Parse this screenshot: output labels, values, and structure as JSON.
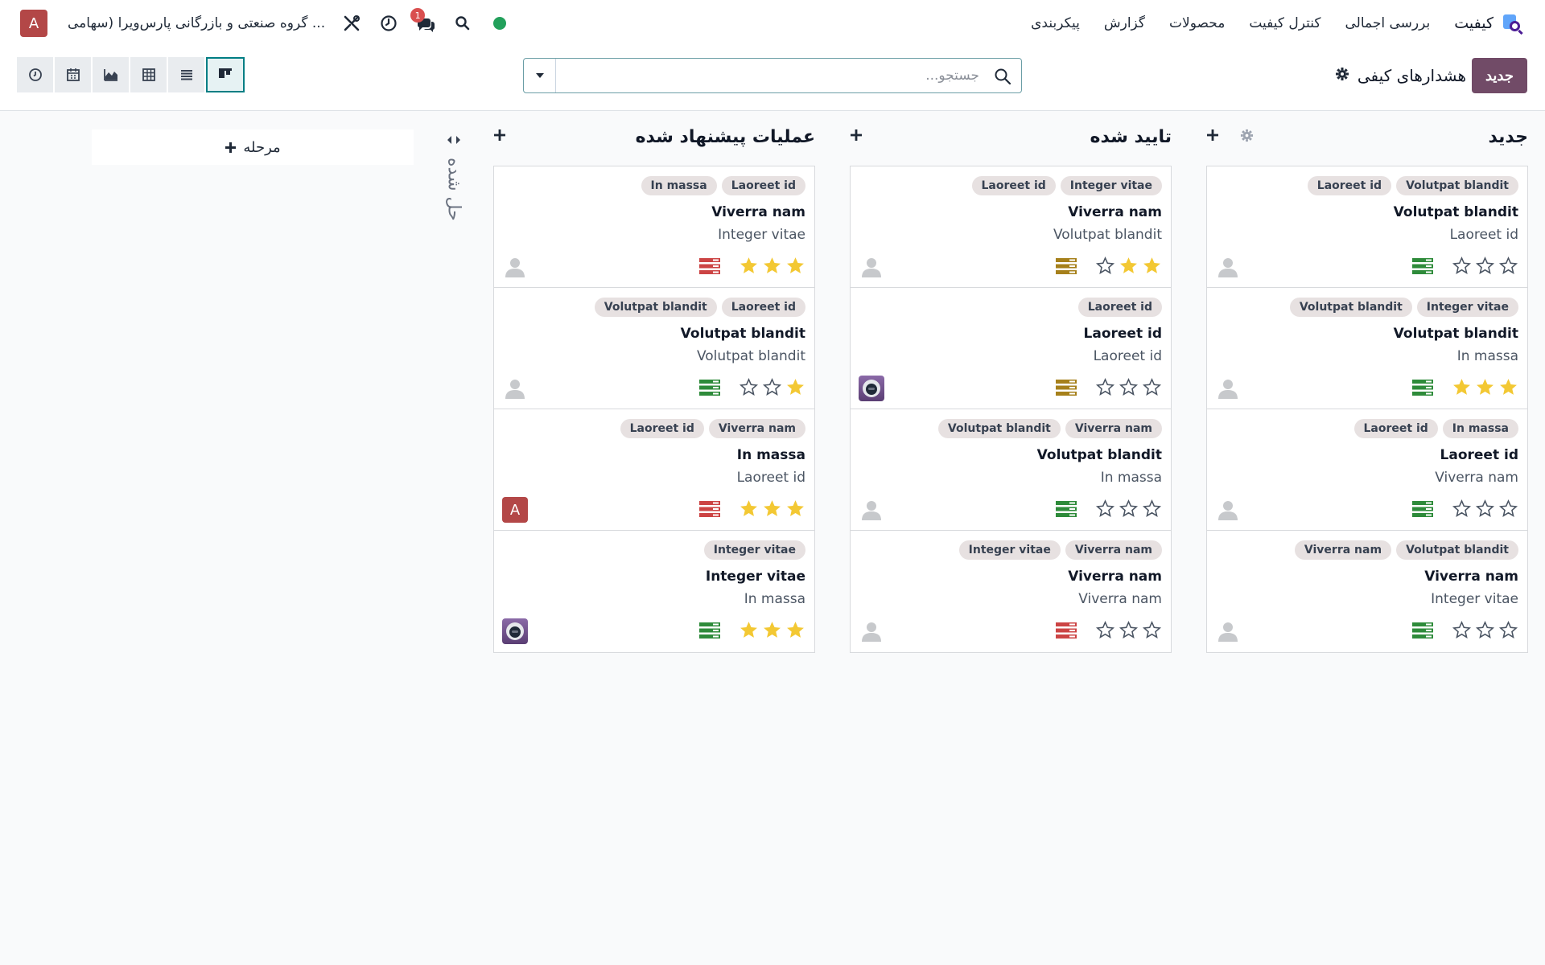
{
  "navbar": {
    "app_name": "کیفیت",
    "menu": [
      "بررسی اجمالی",
      "کنترل کیفیت",
      "محصولات",
      "گزارش",
      "پیکربندی"
    ],
    "user_initial": "A",
    "company": "گروه صنعتی و بازرگانی پارس‌ویرا (سهامی ...",
    "chat_badge": "1",
    "status_color": "#22a05b"
  },
  "control": {
    "new_button": "جدید",
    "breadcrumb": "هشدارهای کیفی",
    "search_placeholder": "جستجو..."
  },
  "add_stage_label": "مرحله",
  "folded_column": {
    "title": "حل شده"
  },
  "columns": [
    {
      "title": "جدید",
      "cards": [
        {
          "tags": [
            "Volutpat blandit",
            "Laoreet id"
          ],
          "title": "Volutpat blandit",
          "subtitle": "Laoreet id",
          "stars": 0,
          "priority": "green",
          "assignee": "placeholder"
        },
        {
          "tags": [
            "Integer vitae",
            "Volutpat blandit"
          ],
          "title": "Volutpat blandit",
          "subtitle": "In massa",
          "stars": 3,
          "priority": "green",
          "assignee": "placeholder"
        },
        {
          "tags": [
            "In massa",
            "Laoreet id"
          ],
          "title": "Laoreet id",
          "subtitle": "Viverra nam",
          "stars": 0,
          "priority": "green",
          "assignee": "placeholder"
        },
        {
          "tags": [
            "Volutpat blandit",
            "Viverra nam"
          ],
          "title": "Viverra nam",
          "subtitle": "Integer vitae",
          "stars": 0,
          "priority": "green",
          "assignee": "placeholder"
        }
      ]
    },
    {
      "title": "تایید شده",
      "cards": [
        {
          "tags": [
            "Integer vitae",
            "Laoreet id"
          ],
          "title": "Viverra nam",
          "subtitle": "Volutpat blandit",
          "stars": 2,
          "priority": "yellow",
          "assignee": "placeholder"
        },
        {
          "tags": [
            "Laoreet id"
          ],
          "title": "Laoreet id",
          "subtitle": "Laoreet id",
          "stars": 0,
          "priority": "yellow",
          "assignee": "robot"
        },
        {
          "tags": [
            "Viverra nam",
            "Volutpat blandit"
          ],
          "title": "Volutpat blandit",
          "subtitle": "In massa",
          "stars": 0,
          "priority": "green",
          "assignee": "placeholder"
        },
        {
          "tags": [
            "Viverra nam",
            "Integer vitae"
          ],
          "title": "Viverra nam",
          "subtitle": "Viverra nam",
          "stars": 0,
          "priority": "red",
          "assignee": "placeholder"
        }
      ]
    },
    {
      "title": "عملیات پیشنهاد شده",
      "cards": [
        {
          "tags": [
            "Laoreet id",
            "In massa"
          ],
          "title": "Viverra nam",
          "subtitle": "Integer vitae",
          "stars": 3,
          "priority": "red",
          "assignee": "placeholder"
        },
        {
          "tags": [
            "Laoreet id",
            "Volutpat blandit"
          ],
          "title": "Volutpat blandit",
          "subtitle": "Volutpat blandit",
          "stars": 1,
          "priority": "green",
          "assignee": "placeholder"
        },
        {
          "tags": [
            "Viverra nam",
            "Laoreet id"
          ],
          "title": "In massa",
          "subtitle": "Laoreet id",
          "stars": 3,
          "priority": "red",
          "assignee": "A"
        },
        {
          "tags": [
            "Integer vitae"
          ],
          "title": "Integer vitae",
          "subtitle": "In massa",
          "stars": 3,
          "priority": "green",
          "assignee": "robot"
        }
      ]
    }
  ],
  "colors": {
    "primary": "#714b67",
    "accent": "#017e84",
    "star": "#f3c833",
    "priority_green": "#2e8b3a",
    "priority_yellow": "#a6801b",
    "priority_red": "#cc4444"
  }
}
